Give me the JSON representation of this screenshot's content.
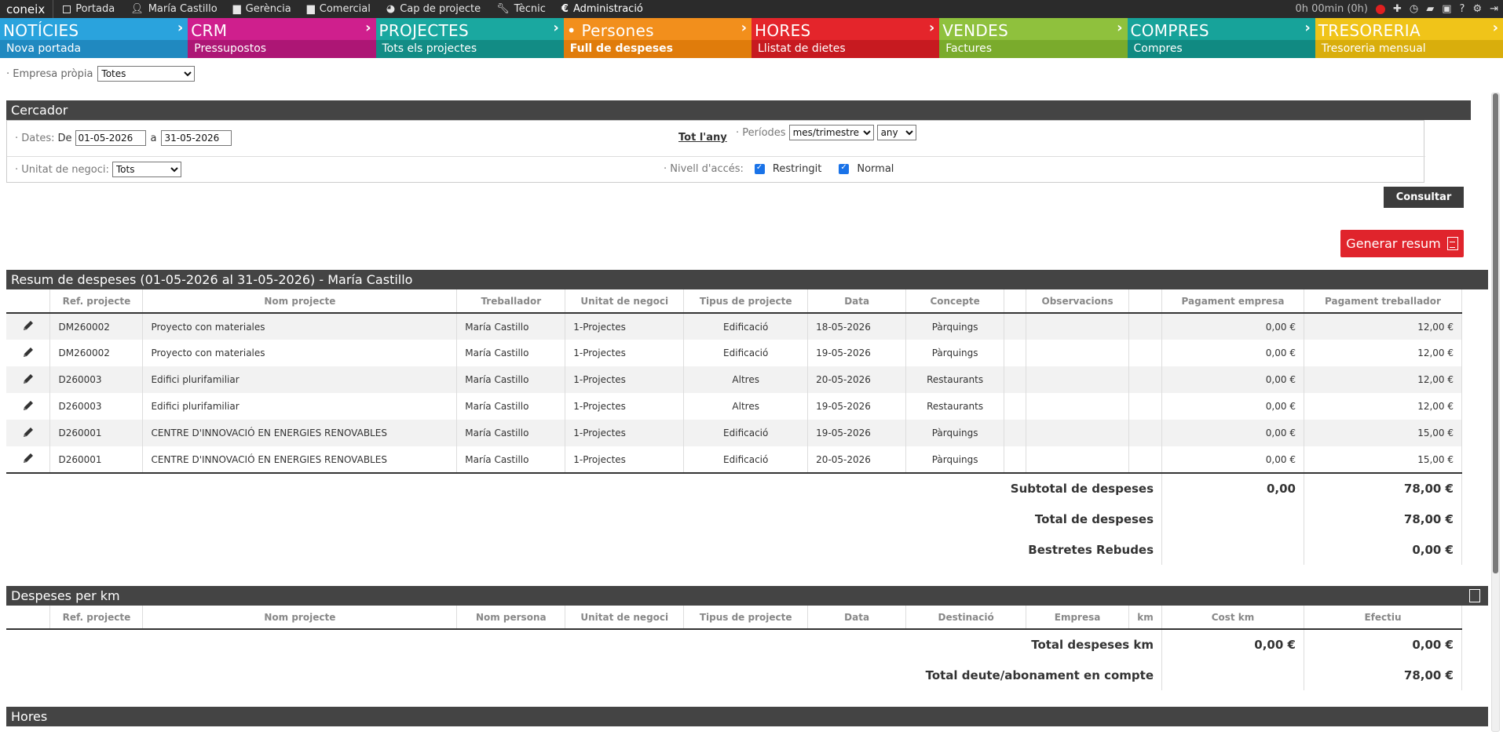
{
  "topbar": {
    "logo": "coneix",
    "items": [
      {
        "label": "Portada",
        "icon": "page-icon"
      },
      {
        "label": "María Castillo",
        "icon": "user-icon"
      },
      {
        "label": "Gerència",
        "icon": "briefcase-icon"
      },
      {
        "label": "Comercial",
        "icon": "bag-icon"
      },
      {
        "label": "Cap de projecte",
        "icon": "chart-icon"
      },
      {
        "label": "Tècnic",
        "icon": "wrench-icon"
      },
      {
        "label": "Administració",
        "icon": "euro-icon"
      }
    ],
    "timer": "0h 00min (0h)"
  },
  "modules": [
    {
      "title": "NOTÍCIES",
      "sub": "Nova portada",
      "color": "#2aa3dd",
      "subcolor": "#2089c0"
    },
    {
      "title": "CRM",
      "sub": "Pressupostos",
      "color": "#cf1f8d",
      "subcolor": "#ad1675"
    },
    {
      "title": "PROJECTES",
      "sub": "Tots els projectes",
      "color": "#1aa8a0",
      "subcolor": "#128c85"
    },
    {
      "title": "• Persones",
      "sub": "Full de despeses",
      "color": "#f28f1c",
      "subcolor": "#e07c0b"
    },
    {
      "title": "HORES",
      "sub": "Llistat de dietes",
      "color": "#e4252b",
      "subcolor": "#c71a20"
    },
    {
      "title": "VENDES",
      "sub": "Factures",
      "color": "#8fc13d",
      "subcolor": "#7aab2c"
    },
    {
      "title": "COMPRES",
      "sub": "Compres",
      "color": "#17a39a",
      "subcolor": "#108a82"
    },
    {
      "title": "TRESORERIA",
      "sub": "Tresoreria mensual",
      "color": "#f0c419",
      "subcolor": "#d9ae0c"
    }
  ],
  "empresa": {
    "label": "· Empresa pròpia",
    "value": "Totes"
  },
  "cercador": {
    "title": "Cercador",
    "dates_label": "· Dates:",
    "de": "De",
    "from": "01-05-2026",
    "a": "a",
    "to": "31-05-2026",
    "tot_any": "Tot l'any",
    "periodes_label": "· Períodes",
    "periode_value": "mes/trimestre",
    "any_value": "any",
    "unitat_label": "· Unitat de negoci:",
    "unitat_value": "Tots",
    "nivell_label": "· Nivell d'accés:",
    "restringit": "Restringit",
    "normal": "Normal",
    "consultar": "Consultar"
  },
  "generar": "Generar resum",
  "resum": {
    "title": "Resum de despeses (01-05-2026 al 31-05-2026) - María Castillo",
    "headers": [
      "",
      "Ref. projecte",
      "Nom projecte",
      "Treballador",
      "Unitat de negoci",
      "Tipus de projecte",
      "Data",
      "Concepte",
      "",
      "Observacions",
      "",
      "Pagament empresa",
      "Pagament treballador"
    ],
    "rows": [
      {
        "ref": "DM260002",
        "nom": "Proyecto con materiales",
        "treb": "María Castillo",
        "unitat": "1-Projectes",
        "tipus": "Edificació",
        "data": "18-05-2026",
        "concepte": "Pàrquings",
        "emp": "0,00 €",
        "trab": "12,00 €"
      },
      {
        "ref": "DM260002",
        "nom": "Proyecto con materiales",
        "treb": "María Castillo",
        "unitat": "1-Projectes",
        "tipus": "Edificació",
        "data": "19-05-2026",
        "concepte": "Pàrquings",
        "emp": "0,00 €",
        "trab": "12,00 €"
      },
      {
        "ref": "D260003",
        "nom": "Edifici plurifamiliar",
        "treb": "María Castillo",
        "unitat": "1-Projectes",
        "tipus": "Altres",
        "data": "20-05-2026",
        "concepte": "Restaurants",
        "emp": "0,00 €",
        "trab": "12,00 €"
      },
      {
        "ref": "D260003",
        "nom": "Edifici plurifamiliar",
        "treb": "María Castillo",
        "unitat": "1-Projectes",
        "tipus": "Altres",
        "data": "19-05-2026",
        "concepte": "Restaurants",
        "emp": "0,00 €",
        "trab": "12,00 €"
      },
      {
        "ref": "D260001",
        "nom": "CENTRE D'INNOVACIÓ EN ENERGIES RENOVABLES",
        "treb": "María Castillo",
        "unitat": "1-Projectes",
        "tipus": "Edificació",
        "data": "19-05-2026",
        "concepte": "Pàrquings",
        "emp": "0,00 €",
        "trab": "15,00 €"
      },
      {
        "ref": "D260001",
        "nom": "CENTRE D'INNOVACIÓ EN ENERGIES RENOVABLES",
        "treb": "María Castillo",
        "unitat": "1-Projectes",
        "tipus": "Edificació",
        "data": "20-05-2026",
        "concepte": "Pàrquings",
        "emp": "0,00 €",
        "trab": "15,00 €"
      }
    ],
    "subtotal_label": "Subtotal de despeses",
    "subtotal_emp": "0,00",
    "subtotal_trab": "78,00 €",
    "total_label": "Total de despeses",
    "total_trab": "78,00 €",
    "bestretes_label": "Bestretes Rebudes",
    "bestretes_trab": "0,00 €"
  },
  "km": {
    "title": "Despeses per km",
    "headers": [
      "",
      "Ref. projecte",
      "Nom projecte",
      "Nom persona",
      "Unitat de negoci",
      "Tipus de projecte",
      "Data",
      "Destinació",
      "Empresa",
      "km",
      "Cost km",
      "Efectiu"
    ],
    "total_label": "Total despeses km",
    "total_cost": "0,00 €",
    "total_efectiu": "0,00 €",
    "deute_label": "Total deute/abonament en compte",
    "deute_value": "78,00 €"
  },
  "hores": {
    "title": "Hores"
  }
}
